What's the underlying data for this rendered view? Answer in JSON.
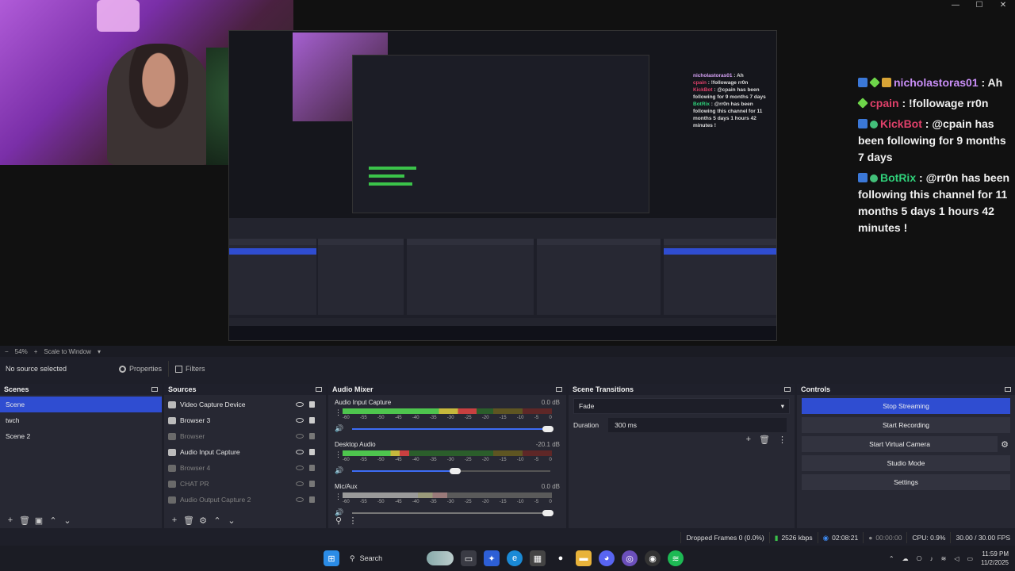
{
  "window": {
    "minimize": "—",
    "maximize": "☐",
    "close": "✕"
  },
  "preview": {
    "nested": {
      "mini_chat": [
        {
          "user": "nicholastoras01",
          "text": " : Ah"
        },
        {
          "user": "cpain",
          "text": " : !followage rr0n"
        },
        {
          "user": "KickBot",
          "text": " : @cpain has been following for 9 months 7 days"
        },
        {
          "user": "BotRix",
          "text": " : @rr0n has been following this channel for 11 months 5 days 1 hours 42 minutes !"
        }
      ]
    },
    "chat": [
      {
        "user": "nicholastoras01",
        "text": " : Ah",
        "color": "#c98ef7"
      },
      {
        "user": "cpain",
        "text": " : !followage rr0n",
        "color": "#e0406a"
      },
      {
        "user": "KickBot",
        "text": " : @cpain has been following for 9 months 7 days",
        "color": "#e0406a"
      },
      {
        "user": "BotRix",
        "text": " : @rr0n has been following this channel for 11 months 5 days 1 hours 42 minutes !",
        "color": "#2fd17a"
      }
    ]
  },
  "zoombar": {
    "minus": "−",
    "zoom": "54%",
    "plus": "+",
    "scale": "Scale to Window"
  },
  "context": {
    "no_source": "No source selected",
    "properties": "Properties",
    "filters": "Filters"
  },
  "scenes": {
    "title": "Scenes",
    "items": [
      "Scene",
      "twch",
      "Scene 2"
    ],
    "active_index": 0
  },
  "sources": {
    "title": "Sources",
    "items": [
      {
        "label": "Video Capture Device",
        "icon": "camera-icon"
      },
      {
        "label": "Browser 3",
        "icon": "globe-icon"
      },
      {
        "label": "Browser",
        "icon": "globe-icon"
      },
      {
        "label": "Audio Input Capture",
        "icon": "mic-icon"
      },
      {
        "label": "Browser 4",
        "icon": "globe-icon"
      },
      {
        "label": "CHAT PR",
        "icon": "globe-icon"
      },
      {
        "label": "Audio Output Capture 2",
        "icon": "speaker-icon"
      }
    ]
  },
  "mixer": {
    "title": "Audio Mixer",
    "ticks": [
      "-60",
      "-55",
      "-50",
      "-45",
      "-40",
      "-35",
      "-30",
      "-25",
      "-20",
      "-15",
      "-10",
      "-5",
      "0"
    ],
    "channels": [
      {
        "name": "Audio Input Capture",
        "db": "0.0 dB",
        "level": 0.64,
        "volume": 1.0,
        "muted": false
      },
      {
        "name": "Desktop Audio",
        "db": "-20.1 dB",
        "level": 0.32,
        "volume": 0.53,
        "muted": false
      },
      {
        "name": "Mic/Aux",
        "db": "0.0 dB",
        "level": 0.5,
        "volume": 1.0,
        "muted": true
      }
    ]
  },
  "transitions": {
    "title": "Scene Transitions",
    "selected": "Fade",
    "duration_label": "Duration",
    "duration_value": "300 ms"
  },
  "controls": {
    "title": "Controls",
    "buttons": [
      "Stop Streaming",
      "Start Recording",
      "Start Virtual Camera",
      "Studio Mode",
      "Settings"
    ]
  },
  "status": {
    "dropped": "Dropped Frames 0 (0.0%)",
    "kbps": "2526 kbps",
    "stream_time": "02:08:21",
    "rec_time": "00:00:00",
    "cpu": "CPU: 0.9%",
    "fps": "30.00 / 30.00 FPS"
  },
  "taskbar": {
    "search": "Search",
    "time": "11:59 PM",
    "date": "11/2/2025"
  },
  "colors": {
    "accent": "#2f4dd1",
    "panel": "#272833",
    "meter_green": "#4ec54e"
  }
}
